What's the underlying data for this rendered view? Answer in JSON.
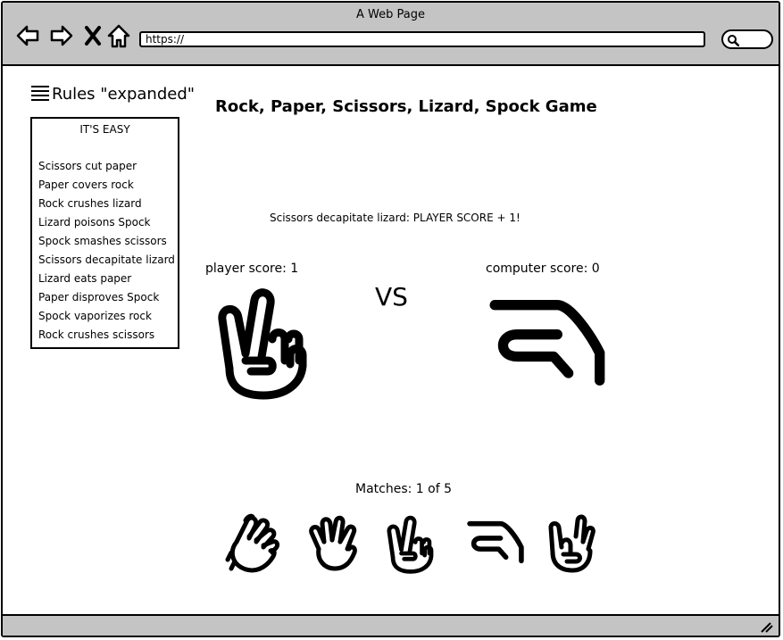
{
  "window": {
    "title": "A Web Page"
  },
  "browser": {
    "url": "https://"
  },
  "rules": {
    "heading": "Rules \"expanded\"",
    "subtitle": "IT'S EASY",
    "items": [
      "Scissors cut paper",
      "Paper covers rock",
      "Rock crushes lizard",
      "Lizard poisons Spock",
      "Spock smashes scissors",
      "Scissors decapitate lizard",
      "Lizard eats paper",
      "Paper disproves Spock",
      "Spock vaporizes rock",
      "Rock crushes scissors"
    ]
  },
  "game": {
    "title": "Rock, Paper, Scissors, Lizard, Spock Game",
    "result": "Scissors decapitate lizard: PLAYER SCORE + 1!",
    "player_score": "player score: 1",
    "computer_score": "computer score: 0",
    "vs": "VS",
    "player_choice_icon": "scissors-hand-icon",
    "computer_choice_icon": "lizard-hand-icon",
    "matches": "Matches: 1 of 5",
    "choices": [
      {
        "name": "rock",
        "icon": "rock-hand-icon"
      },
      {
        "name": "paper",
        "icon": "paper-hand-icon"
      },
      {
        "name": "scissors",
        "icon": "scissors-hand-icon"
      },
      {
        "name": "lizard",
        "icon": "lizard-hand-icon"
      },
      {
        "name": "spock",
        "icon": "spock-hand-icon"
      }
    ]
  },
  "colors": {
    "chrome": "#c4c4c4",
    "ink": "#000000",
    "background": "#ffffff"
  }
}
